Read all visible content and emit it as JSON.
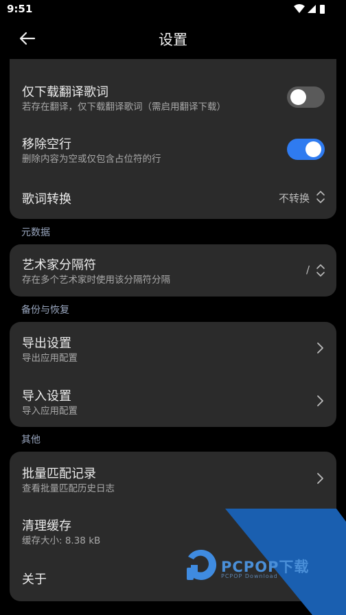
{
  "status": {
    "time": "9:51"
  },
  "appbar": {
    "title": "设置"
  },
  "lyrics_card": {
    "translate_only": {
      "title": "仅下载翻译歌词",
      "subtitle": "若存在翻译，仅下载翻译歌词（需启用翻译下载）",
      "enabled": false
    },
    "remove_blank": {
      "title": "移除空行",
      "subtitle": "删除内容为空或仅包含占位符的行",
      "enabled": true
    },
    "convert": {
      "title": "歌词转换",
      "value": "不转换"
    }
  },
  "metadata": {
    "section": "元数据",
    "separator": {
      "title": "艺术家分隔符",
      "subtitle": "存在多个艺术家时使用该分隔符分隔",
      "value": "/"
    }
  },
  "backup": {
    "section": "备份与恢复",
    "export": {
      "title": "导出设置",
      "subtitle": "导出应用配置"
    },
    "import": {
      "title": "导入设置",
      "subtitle": "导入应用配置"
    }
  },
  "other": {
    "section": "其他",
    "batch": {
      "title": "批量匹配记录",
      "subtitle": "查看批量匹配历史日志"
    },
    "cache": {
      "title": "清理缓存",
      "subtitle": "缓存大小: 8.38 kB"
    },
    "about": {
      "title": "关于"
    }
  },
  "watermark": {
    "brand": "PCPOP下载",
    "sub": "PCPOP Download"
  },
  "colors": {
    "accent": "#2f7bf0",
    "card": "#2b2b2b",
    "background": "#000000",
    "section_label": "#9aa7bf"
  }
}
